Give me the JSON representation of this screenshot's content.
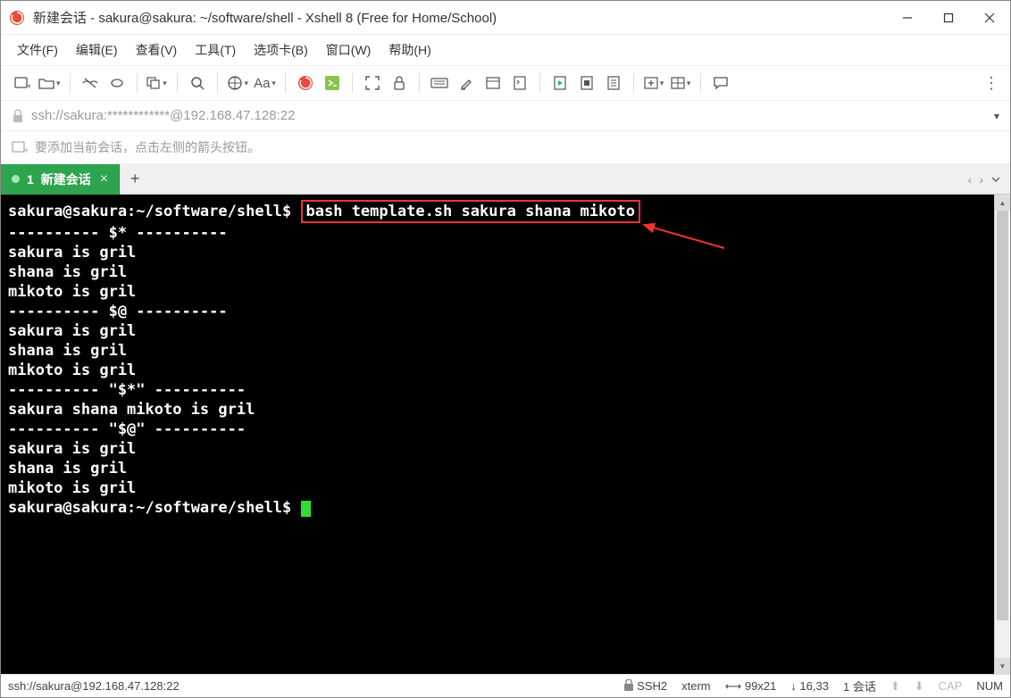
{
  "window": {
    "title": "新建会话 - sakura@sakura: ~/software/shell - Xshell 8 (Free for Home/School)"
  },
  "menu": {
    "file": "文件(F)",
    "edit": "编辑(E)",
    "view": "查看(V)",
    "tools": "工具(T)",
    "tabs": "选项卡(B)",
    "window": "窗口(W)",
    "help": "帮助(H)"
  },
  "toolbar": {
    "font_label": "Aa"
  },
  "addressbar": {
    "url": "ssh://sakura:************@192.168.47.128:22"
  },
  "hintbar": {
    "text": "要添加当前会话，点击左侧的箭头按钮。"
  },
  "tab": {
    "index": "1",
    "label": "新建会话"
  },
  "terminal": {
    "prompt1": "sakura@sakura:~/software/shell$ ",
    "command": "bash template.sh sakura shana mikoto",
    "lines": [
      "---------- $* ----------",
      "sakura is gril",
      "shana is gril",
      "mikoto is gril",
      "---------- $@ ----------",
      "sakura is gril",
      "shana is gril",
      "mikoto is gril",
      "---------- \"$*\" ----------",
      "sakura shana mikoto is gril",
      "---------- \"$@\" ----------",
      "sakura is gril",
      "shana is gril",
      "mikoto is gril"
    ],
    "prompt2": "sakura@sakura:~/software/shell$ "
  },
  "statusbar": {
    "conn": "ssh://sakura@192.168.47.128:22",
    "protocol": "SSH2",
    "term": "xterm",
    "size": "99x21",
    "pos": "16,33",
    "sessions_num": "1",
    "sessions_label": "会话",
    "cap": "CAP",
    "num": "NUM"
  }
}
